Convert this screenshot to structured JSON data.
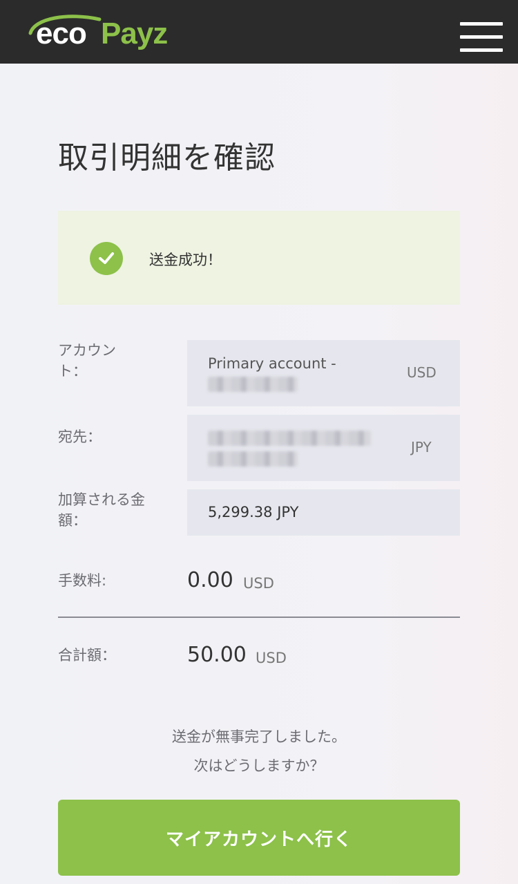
{
  "header": {
    "logo_eco": "eco",
    "logo_payz": "Payz",
    "menu_icon": "hamburger-menu-icon"
  },
  "page": {
    "title": "取引明細を確認"
  },
  "alert": {
    "icon": "check-circle-icon",
    "text": "送金成功！",
    "color": "#8dc14a"
  },
  "details": {
    "account": {
      "label": "アカウント：",
      "value": "Primary account -",
      "currency": "USD"
    },
    "recipient": {
      "label": "宛先：",
      "currency": "JPY"
    },
    "credited_amount": {
      "label": "加算される金額：",
      "value": "5,299.38 JPY"
    },
    "fee": {
      "label": "手数料:",
      "value": "0.00",
      "currency": "USD"
    },
    "total": {
      "label": "合計額：",
      "value": "50.00",
      "currency": "USD"
    }
  },
  "message": {
    "line1": "送金が無事完了しました。",
    "line2": "次はどうしますか？"
  },
  "actions": {
    "go_to_account": "マイアカウントへ行く"
  }
}
